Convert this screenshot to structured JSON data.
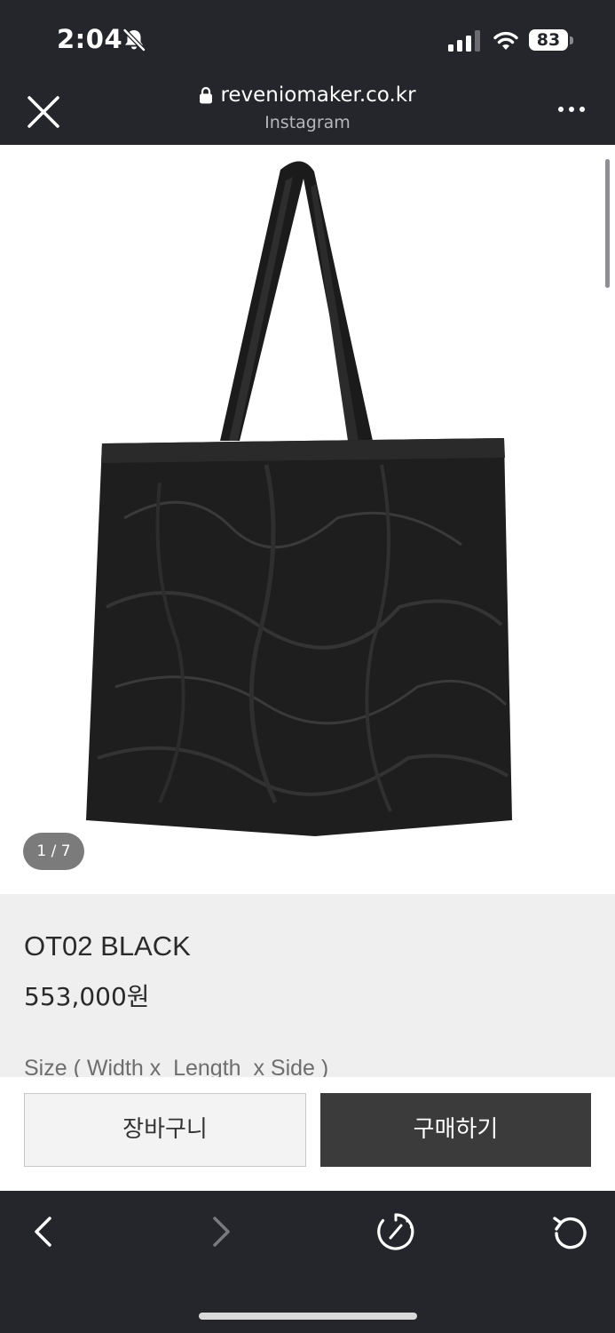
{
  "status_bar": {
    "time": "2:04",
    "battery": "83",
    "icons": [
      "bell-off-icon",
      "cellular-signal-icon",
      "wifi-icon",
      "battery-icon"
    ]
  },
  "browser": {
    "domain": "reveniomaker.co.kr",
    "source": "Instagram",
    "icons": [
      "close-icon",
      "lock-icon",
      "more-icon"
    ]
  },
  "product": {
    "image_alt": "Black crinkled leather tote bag",
    "pager": "1 / 7",
    "name": "OT02 BLACK",
    "price": "553,000원",
    "size_label": "Size ( Width x  Length  x Side )"
  },
  "actions": {
    "cart_label": "장바구니",
    "buy_label": "구매하기"
  },
  "toolbar": {
    "icons": [
      "back-icon",
      "forward-icon",
      "compass-icon",
      "reload-icon"
    ]
  },
  "colors": {
    "chrome_bg": "#25262b",
    "info_bg": "#efefef",
    "buy_button": "#3b3b3b",
    "cart_button": "#f3f3f3"
  }
}
